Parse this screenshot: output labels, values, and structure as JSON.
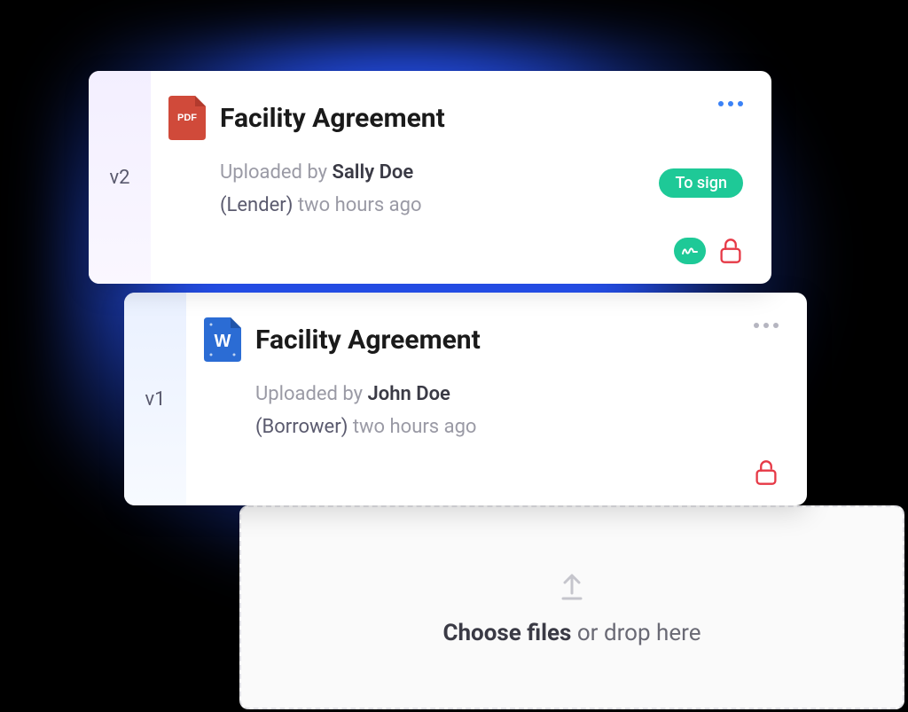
{
  "documents": [
    {
      "version": "v2",
      "file_type": "PDF",
      "title": "Facility Agreement",
      "uploaded_prefix": "Uploaded by ",
      "uploader": "Sally Doe",
      "role": "Lender",
      "time_ago": "two hours ago",
      "badge": "To sign",
      "has_signature": true,
      "locked": true,
      "menu_color": "blue"
    },
    {
      "version": "v1",
      "file_type": "DOCX",
      "title": "Facility Agreement",
      "uploaded_prefix": "Uploaded by ",
      "uploader": "John Doe",
      "role": "Borrower",
      "time_ago": "two hours ago",
      "badge": null,
      "has_signature": false,
      "locked": true,
      "menu_color": "gray"
    }
  ],
  "dropzone": {
    "bold": "Choose files",
    "rest": " or drop here"
  },
  "colors": {
    "accent_green": "#1ec997",
    "lock_red": "#e63946",
    "word_blue": "#2b6cd4",
    "pdf_red": "#d04a3a"
  }
}
